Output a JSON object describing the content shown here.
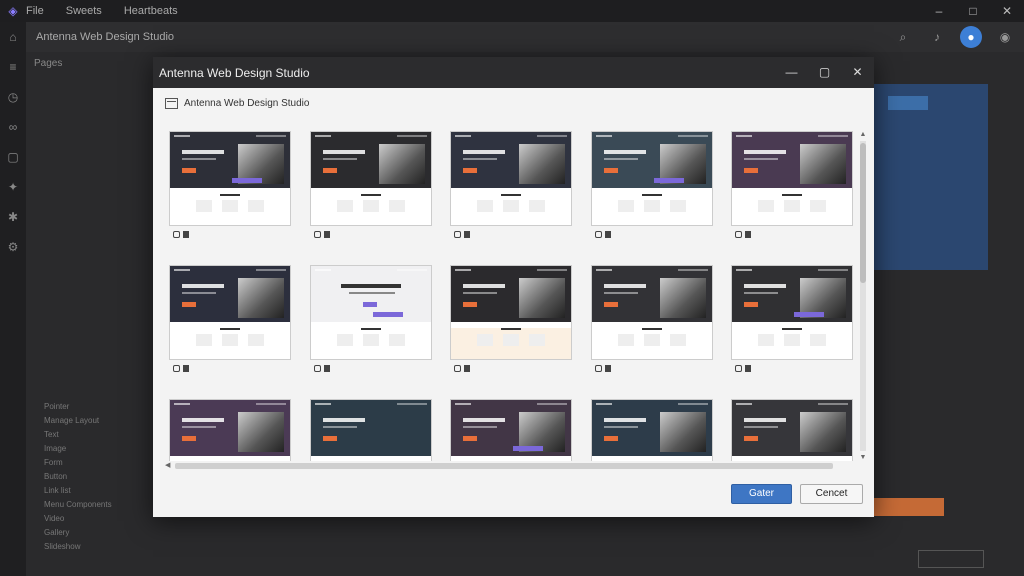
{
  "menubar": {
    "items": [
      "File",
      "Sweets",
      "Heartbeats"
    ]
  },
  "app": {
    "title": "Antenna Web Design Studio",
    "subhead": "Pages"
  },
  "left_panel": {
    "items": [
      "Pointer",
      "Manage Layout",
      "Text",
      "Image",
      "Form",
      "Button",
      "Link list",
      "Menu Components",
      "Video",
      "Gallery",
      "Slideshow"
    ]
  },
  "dialog": {
    "title": "Antenna Web Design Studio",
    "subtitle": "Antenna Web Design Studio",
    "ok_label": "Gater",
    "cancel_label": "Cencet"
  },
  "templates": [
    {
      "hero": "#2d2f38",
      "img": true,
      "body": "#ffffff"
    },
    {
      "hero": "#2b2b2e",
      "img": true,
      "body": "#ffffff"
    },
    {
      "hero": "#2f3340",
      "img": true,
      "body": "#ffffff"
    },
    {
      "hero": "#3a4a56",
      "img": true,
      "body": "#ffffff"
    },
    {
      "hero": "#4a3a52",
      "img": true,
      "body": "#ffffff"
    },
    {
      "hero": "#2c2f3d",
      "img": true,
      "body": "#ffffff"
    },
    {
      "hero": "#f0f0f2",
      "img": false,
      "body": "#ffffff"
    },
    {
      "hero": "#2b2a2d",
      "img": true,
      "body": "#fbf0e2"
    },
    {
      "hero": "#323236",
      "img": true,
      "body": "#ffffff"
    },
    {
      "hero": "#303033",
      "img": true,
      "body": "#ffffff"
    },
    {
      "hero": "#4b3a55",
      "img": true,
      "body": "#ffffff"
    },
    {
      "hero": "#2c3c48",
      "img": false,
      "body": "#ffffff"
    },
    {
      "hero": "#423646",
      "img": true,
      "body": "#ffffff"
    },
    {
      "hero": "#2d3c4a",
      "img": true,
      "body": "#ffffff"
    },
    {
      "hero": "#36363a",
      "img": true,
      "body": "#ffffff"
    }
  ],
  "colors": {
    "accent": "#3e76c4",
    "cta": "#e86f3a",
    "purple": "#7b68d9"
  }
}
